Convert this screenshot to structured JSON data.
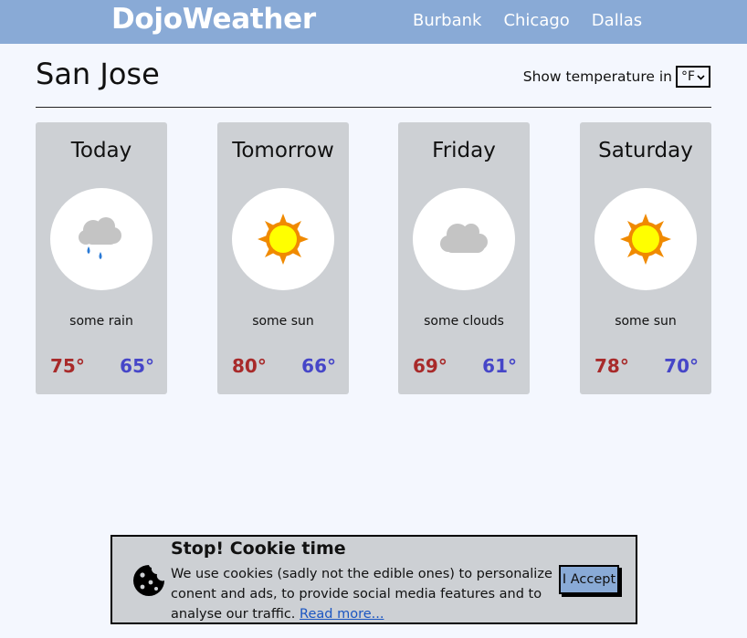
{
  "header": {
    "brand": "DojoWeather",
    "nav": [
      "Burbank",
      "Chicago",
      "Dallas"
    ],
    "background_color": "#89aad6"
  },
  "city": "San Jose",
  "units": {
    "label": "Show temperature in",
    "selected": "°F"
  },
  "forecast": [
    {
      "day": "Today",
      "icon": "rain-cloud-icon",
      "desc": "some rain",
      "high": "75°",
      "low": "65°"
    },
    {
      "day": "Tomorrow",
      "icon": "sun-icon",
      "desc": "some sun",
      "high": "80°",
      "low": "66°"
    },
    {
      "day": "Friday",
      "icon": "cloud-icon",
      "desc": "some clouds",
      "high": "69°",
      "low": "61°"
    },
    {
      "day": "Saturday",
      "icon": "sun-icon",
      "desc": "some sun",
      "high": "78°",
      "low": "70°"
    }
  ],
  "colors": {
    "high_temp": "#a82a2a",
    "low_temp": "#4646c8",
    "card_bg": "#cdd0d4",
    "page_bg": "#f4f7fe"
  },
  "cookie": {
    "title": "Stop! Cookie time",
    "text": "We use cookies (sadly not the edible ones) to personalize conent and ads, to provide social media features and to analyse our traffic.",
    "link": "Read more...",
    "accept": "I Accept"
  }
}
